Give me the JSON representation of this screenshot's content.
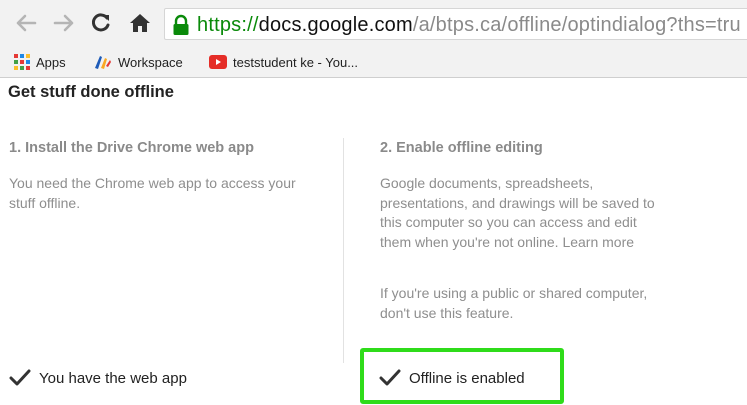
{
  "toolbar": {
    "back_icon": "arrow-left-icon",
    "forward_icon": "arrow-right-icon",
    "reload_icon": "reload-icon",
    "home_icon": "home-icon",
    "url": {
      "scheme": "https://",
      "host": "docs.google.com",
      "path": "/a/btps.ca/offline/optindialog?ths=tru"
    }
  },
  "bookmarks": [
    {
      "label": "Apps",
      "icon": "apps-grid-icon"
    },
    {
      "label": "Workspace",
      "icon": "workspace-logo-icon"
    },
    {
      "label": "teststudent ke - You...",
      "icon": "youtube-icon"
    }
  ],
  "page": {
    "title": "Get stuff done offline",
    "step1": {
      "title": "1. Install the Drive Chrome web app",
      "text": "You need the Chrome web app to access your stuff offline.",
      "status": "You have the web app"
    },
    "step2": {
      "title": "2. Enable offline editing",
      "text": "Google documents, spreadsheets, presentations, and drawings will be saved to this computer so you can access and edit them when you're not online. Learn more",
      "warning": "If you're using a public or shared computer, don't use this feature.",
      "status": "Offline is enabled"
    }
  },
  "colors": {
    "secure_green": "#0a8a0a",
    "highlight_green": "#2fdc1a",
    "muted_text": "#8e8e8e"
  }
}
